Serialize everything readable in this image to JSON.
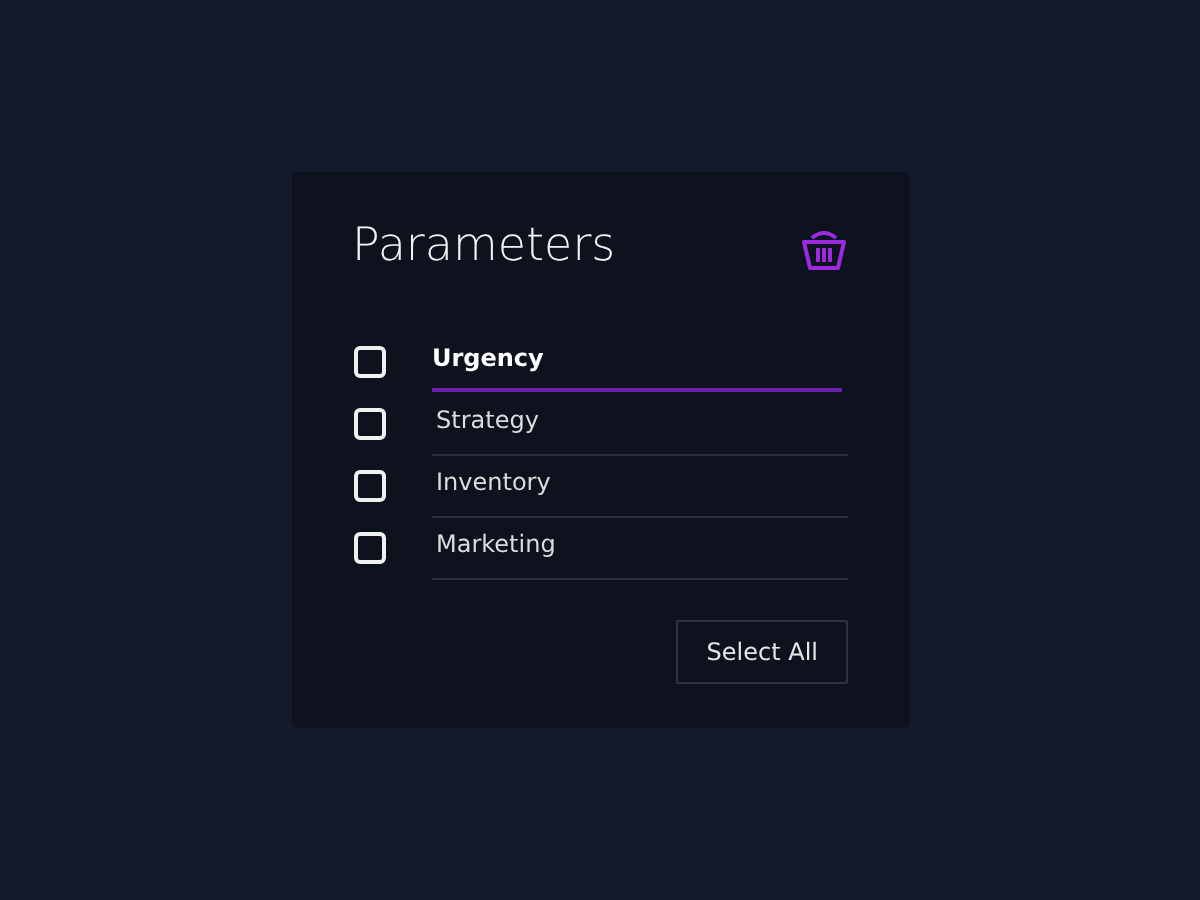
{
  "panel": {
    "title": "Parameters"
  },
  "items": [
    {
      "label": "Urgency",
      "checked": false,
      "selected": true
    },
    {
      "label": "Strategy",
      "checked": false,
      "selected": false
    },
    {
      "label": "Inventory",
      "checked": false,
      "selected": false
    },
    {
      "label": "Marketing",
      "checked": false,
      "selected": false
    }
  ],
  "buttons": [
    "Select All"
  ]
}
